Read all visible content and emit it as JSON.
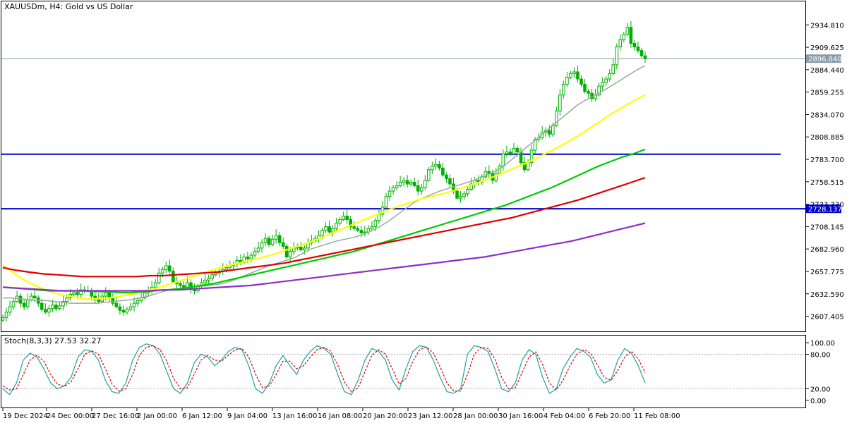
{
  "chart_data": [
    {
      "type": "line",
      "title": "XAUUSDm, H4:  Gold vs US Dollar",
      "ylim": [
        2592,
        2958
      ],
      "y_ticks": [
        "2934.810",
        "2909.625",
        "2884.440",
        "2859.255",
        "2834.070",
        "2808.885",
        "2783.700",
        "2758.515",
        "2733.330",
        "2708.145",
        "2682.960",
        "2657.775",
        "2632.590",
        "2607.405"
      ],
      "x_ticks": [
        "19 Dec 2024",
        "24 Dec 00:00",
        "27 Dec 16:00",
        "2 Jan 00:00",
        "6 Jan 12:00",
        "9 Jan 04:00",
        "13 Jan 16:00",
        "16 Jan 08:00",
        "20 Jan 20:00",
        "23 Jan 12:00",
        "28 Jan 00:00",
        "30 Jan 16:00",
        "4 Feb 04:00",
        "6 Feb 20:00",
        "11 Feb 08:00"
      ],
      "current_price": "2896.840",
      "horizontal_levels": [
        {
          "value": 2789.5,
          "color": "#0000cc"
        },
        {
          "value": 2728.137,
          "label": "2728.137",
          "color": "#0000cc"
        }
      ],
      "candles_close": [
        2606,
        2612,
        2618,
        2624,
        2630,
        2622,
        2618,
        2626,
        2630,
        2628,
        2622,
        2615,
        2612,
        2616,
        2620,
        2616,
        2619,
        2624,
        2628,
        2632,
        2634,
        2632,
        2637,
        2636,
        2636,
        2630,
        2626,
        2624,
        2630,
        2634,
        2628,
        2622,
        2618,
        2614,
        2612,
        2615,
        2618,
        2622,
        2625,
        2628,
        2634,
        2636,
        2640,
        2645,
        2656,
        2660,
        2664,
        2658,
        2646,
        2644,
        2642,
        2640,
        2645,
        2638,
        2636,
        2641,
        2645,
        2648,
        2650,
        2654,
        2656,
        2658,
        2660,
        2662,
        2664,
        2666,
        2670,
        2668,
        2674,
        2672,
        2676,
        2680,
        2684,
        2690,
        2695,
        2688,
        2694,
        2698,
        2690,
        2686,
        2674,
        2680,
        2684,
        2685,
        2682,
        2684,
        2690,
        2692,
        2695,
        2698,
        2704,
        2708,
        2702,
        2706,
        2712,
        2716,
        2720,
        2716,
        2708,
        2706,
        2704,
        2701,
        2702,
        2706,
        2708,
        2715,
        2722,
        2730,
        2742,
        2748,
        2752,
        2754,
        2758,
        2760,
        2756,
        2758,
        2754,
        2748,
        2752,
        2760,
        2772,
        2776,
        2778,
        2774,
        2766,
        2762,
        2756,
        2748,
        2740,
        2742,
        2745,
        2750,
        2756,
        2760,
        2758,
        2764,
        2770,
        2768,
        2760,
        2768,
        2776,
        2790,
        2792,
        2790,
        2796,
        2792,
        2780,
        2772,
        2780,
        2794,
        2806,
        2808,
        2814,
        2816,
        2812,
        2822,
        2838,
        2856,
        2868,
        2876,
        2880,
        2882,
        2874,
        2868,
        2860,
        2858,
        2852,
        2856,
        2866,
        2870,
        2874,
        2880,
        2890,
        2910,
        2918,
        2924,
        2932,
        2914,
        2910,
        2906,
        2900,
        2896.84
      ],
      "series": [
        {
          "name": "MA20",
          "color": "#9aaa9a",
          "values": [
            2628,
            2628,
            2627,
            2626,
            2625,
            2625,
            2624,
            2623,
            2622,
            2622,
            2622,
            2622,
            2623,
            2624,
            2625,
            2626,
            2628,
            2630,
            2633,
            2636,
            2638,
            2639,
            2640,
            2641,
            2642,
            2643,
            2645,
            2648,
            2652,
            2656,
            2660,
            2664,
            2667,
            2670,
            2673,
            2678,
            2683,
            2686,
            2689,
            2692,
            2694,
            2696,
            2699,
            2703,
            2708,
            2714,
            2721,
            2728,
            2735,
            2740,
            2744,
            2748,
            2751,
            2754,
            2757,
            2760,
            2764,
            2768,
            2773,
            2780,
            2788,
            2796,
            2804,
            2812,
            2820,
            2828,
            2836,
            2844,
            2850,
            2855,
            2860,
            2866,
            2872,
            2878,
            2884,
            2889
          ]
        },
        {
          "name": "MA50",
          "color": "#ffff00",
          "values": [
            2665,
            2656,
            2648,
            2642,
            2637,
            2633,
            2630,
            2628,
            2627,
            2627,
            2628,
            2630,
            2632,
            2635,
            2638,
            2641,
            2645,
            2649,
            2653,
            2657,
            2661,
            2664,
            2667,
            2670,
            2673,
            2676,
            2680,
            2684,
            2688,
            2692,
            2697,
            2702,
            2707,
            2712,
            2717,
            2722,
            2727,
            2731,
            2735,
            2739,
            2742,
            2745,
            2748,
            2752,
            2756,
            2760,
            2765,
            2770,
            2775,
            2780,
            2786,
            2792,
            2798,
            2805,
            2812,
            2820,
            2828,
            2836,
            2843,
            2850,
            2856
          ]
        },
        {
          "name": "MA100",
          "color": "#00cc00",
          "values": [
            2640,
            2639,
            2638,
            2637,
            2636,
            2636,
            2636,
            2636,
            2635,
            2635,
            2634,
            2634,
            2635,
            2636,
            2637,
            2638,
            2640,
            2642,
            2644,
            2647,
            2650,
            2653,
            2656,
            2659,
            2662,
            2665,
            2668,
            2671,
            2674,
            2677,
            2680,
            2684,
            2688,
            2692,
            2696,
            2700,
            2704,
            2708,
            2712,
            2716,
            2720,
            2724,
            2728,
            2732,
            2737,
            2742,
            2747,
            2752,
            2758,
            2764,
            2770,
            2776,
            2781,
            2786,
            2790,
            2795
          ]
        },
        {
          "name": "MA200",
          "color": "#dd0000",
          "values": [
            2662,
            2659,
            2657,
            2655,
            2654,
            2653,
            2652,
            2652,
            2652,
            2652,
            2652,
            2653,
            2653,
            2654,
            2655,
            2656,
            2657,
            2659,
            2661,
            2663,
            2665,
            2667,
            2670,
            2673,
            2676,
            2679,
            2682,
            2685,
            2688,
            2691,
            2694,
            2697,
            2700,
            2703,
            2706,
            2709,
            2712,
            2715,
            2718,
            2722,
            2726,
            2730,
            2734,
            2738,
            2743,
            2748,
            2753,
            2758,
            2763
          ]
        },
        {
          "name": "MA400",
          "color": "#8b2fc9",
          "values": [
            2640,
            2639,
            2638,
            2637,
            2636,
            2636,
            2636,
            2636,
            2636,
            2636,
            2636,
            2637,
            2637,
            2638,
            2639,
            2640,
            2641,
            2642,
            2644,
            2646,
            2648,
            2650,
            2652,
            2654,
            2656,
            2658,
            2660,
            2662,
            2664,
            2666,
            2668,
            2670,
            2672,
            2674,
            2677,
            2680,
            2683,
            2686,
            2689,
            2692,
            2696,
            2700,
            2704,
            2708,
            2712
          ]
        }
      ]
    },
    {
      "type": "line",
      "title": "Stoch(8,3,3) 27.53 32.27",
      "ylim": [
        -10,
        110
      ],
      "y_ticks": [
        "100.00",
        "80.00",
        "20.00",
        "0.00"
      ],
      "levels": [
        80,
        20
      ],
      "series": [
        {
          "name": "main",
          "color": "#20a0a0",
          "values": [
            20,
            10,
            30,
            70,
            82,
            75,
            55,
            30,
            20,
            25,
            40,
            75,
            88,
            85,
            70,
            35,
            15,
            12,
            30,
            70,
            92,
            98,
            95,
            80,
            50,
            20,
            12,
            30,
            65,
            80,
            75,
            60,
            70,
            85,
            92,
            88,
            60,
            20,
            12,
            30,
            60,
            78,
            60,
            45,
            70,
            85,
            95,
            90,
            80,
            45,
            15,
            10,
            35,
            70,
            90,
            85,
            70,
            35,
            18,
            55,
            85,
            95,
            92,
            70,
            40,
            15,
            12,
            20,
            80,
            95,
            92,
            85,
            55,
            20,
            15,
            30,
            70,
            88,
            80,
            40,
            12,
            20,
            55,
            75,
            90,
            85,
            75,
            45,
            30,
            35,
            70,
            90,
            82,
            60,
            30
          ]
        },
        {
          "name": "signal",
          "color": "#dd0000",
          "values": [
            25,
            18,
            20,
            45,
            70,
            78,
            68,
            45,
            28,
            24,
            32,
            55,
            80,
            86,
            80,
            55,
            28,
            16,
            20,
            45,
            78,
            92,
            95,
            88,
            68,
            38,
            20,
            22,
            45,
            70,
            78,
            70,
            68,
            78,
            88,
            90,
            75,
            45,
            22,
            25,
            45,
            68,
            68,
            55,
            60,
            75,
            88,
            92,
            85,
            62,
            32,
            15,
            22,
            50,
            78,
            88,
            80,
            55,
            28,
            38,
            68,
            88,
            93,
            82,
            58,
            30,
            16,
            16,
            45,
            80,
            92,
            90,
            72,
            40,
            20,
            22,
            48,
            75,
            84,
            62,
            30,
            18,
            35,
            60,
            80,
            88,
            82,
            62,
            40,
            35,
            52,
            75,
            85,
            72,
            48
          ]
        }
      ]
    }
  ]
}
